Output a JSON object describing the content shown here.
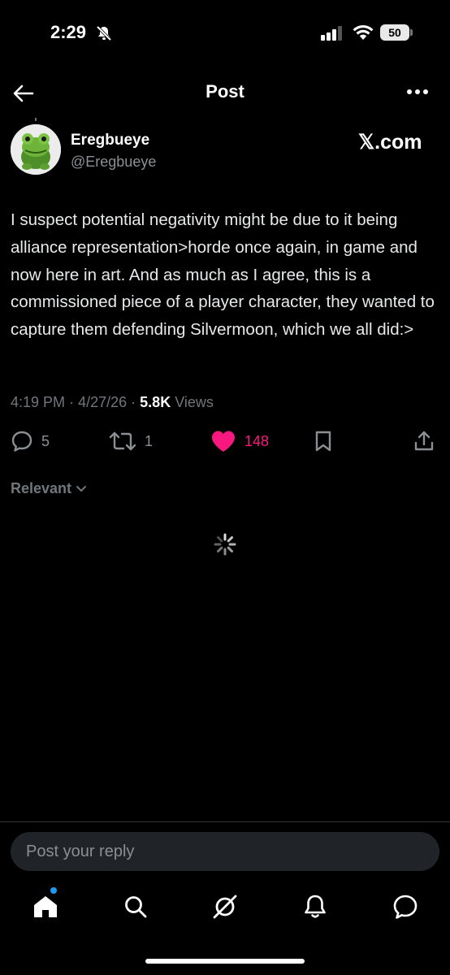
{
  "status_bar": {
    "time": "2:29",
    "battery": "50"
  },
  "header": {
    "title": "Post"
  },
  "author": {
    "name": "Eregbueye",
    "handle": "@Eregbueye",
    "source": "𝕏.com"
  },
  "post": {
    "text": "I suspect potential negativity might be due to it being alliance representation>horde once again, in game and now here in art. And as much as I agree, this is a commissioned piece of a player character, they wanted to capture them defending Silvermoon, which we all did:>",
    "time": "4:19 PM",
    "sep1": "·",
    "date": "4/27/26",
    "sep2": "·",
    "views_count": "5.8K",
    "views_label": "Views"
  },
  "actions": {
    "replies": "5",
    "reposts": "1",
    "likes": "148",
    "like_color": "#f91880"
  },
  "replies_filter": {
    "label": "Relevant"
  },
  "reply_box": {
    "placeholder": "Post your reply"
  },
  "bottom_nav": [
    "home-icon",
    "search-icon",
    "grok-icon",
    "notifications-icon",
    "messages-icon"
  ]
}
